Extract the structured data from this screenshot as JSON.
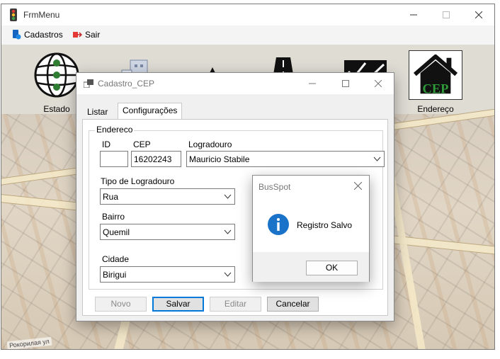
{
  "main_window": {
    "title": "FrmMenu",
    "menu": {
      "cadastros": "Cadastros",
      "sair": "Sair"
    }
  },
  "toolbar": {
    "tiles": [
      {
        "label": "Estado",
        "icon": "globe-icon"
      },
      {
        "label": "",
        "icon": "city-icon"
      },
      {
        "label": "",
        "icon": "star-icon"
      },
      {
        "label": "",
        "icon": "road-icon"
      },
      {
        "label": "",
        "icon": "map-icon"
      },
      {
        "label": "Endereço",
        "icon": "house-cep-icon",
        "badge": "CEP"
      }
    ]
  },
  "map_label": "Рокорилая ул",
  "cep_window": {
    "title": "Cadastro_CEP",
    "tabs": [
      "Listar",
      "Configurações"
    ],
    "active_tab": "Configurações",
    "group_title": "Endereco",
    "fields": {
      "id": {
        "label": "ID",
        "value": ""
      },
      "cep": {
        "label": "CEP",
        "value": "16202243"
      },
      "logradouro": {
        "label": "Logradouro",
        "value": "Mauricio Stabile"
      },
      "tipo_logradouro": {
        "label": "Tipo de Logradouro",
        "value": "Rua"
      },
      "bairro": {
        "label": "Bairro",
        "value": "Quemil"
      },
      "cidade": {
        "label": "Cidade",
        "value": "Birigui"
      }
    },
    "buttons": {
      "novo": "Novo",
      "salvar": "Salvar",
      "editar": "Editar",
      "cancelar": "Cancelar"
    }
  },
  "message_box": {
    "title": "BusSpot",
    "message": "Registro Salvo",
    "ok": "OK"
  },
  "colors": {
    "accent": "#0078d7",
    "info_icon": "#1a73c8",
    "house_badge_green": "#2e9a3a"
  }
}
